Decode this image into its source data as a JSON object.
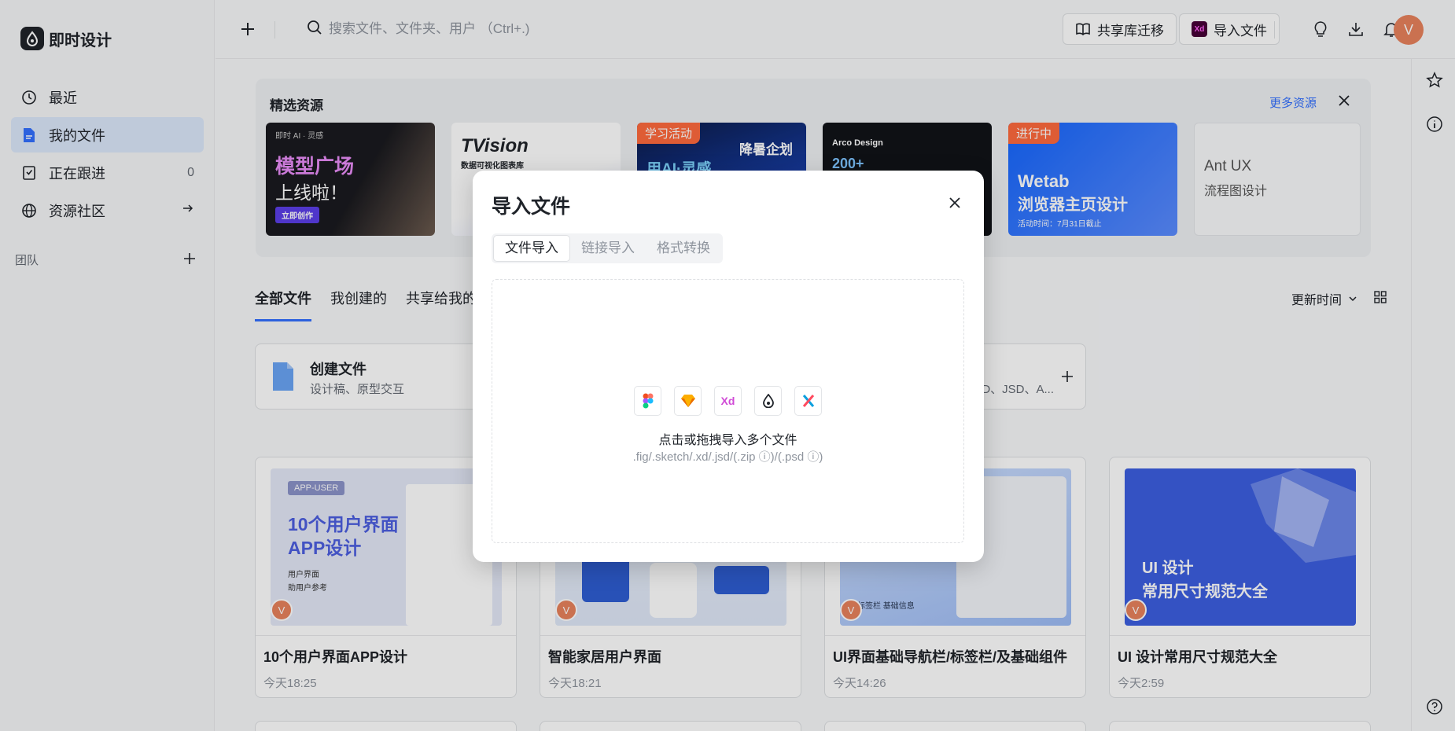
{
  "app": {
    "name": "即时设计"
  },
  "sidebar": {
    "items": [
      {
        "label": "最近",
        "icon": "clock-icon"
      },
      {
        "label": "我的文件",
        "icon": "file-icon",
        "active": true
      },
      {
        "label": "正在跟进",
        "icon": "bookmark-icon",
        "count": "0"
      },
      {
        "label": "资源社区",
        "icon": "globe-icon"
      }
    ],
    "team_label": "团队"
  },
  "topbar": {
    "search_placeholder": "搜索文件、文件夹、用户 （Ctrl+.)",
    "share_button": "共享库迁移",
    "import_button": "导入文件",
    "import_badge": "Xd",
    "avatar": "V"
  },
  "featured": {
    "title": "精选资源",
    "more": "更多资源",
    "banners": [
      {
        "top_text": "即时 AI · 灵感",
        "line1": "模型广场",
        "line2": "上线啦！",
        "cta": "立即创作"
      },
      {
        "line1": "TVision",
        "line2": "数据可视化图表库"
      },
      {
        "tag": "学习活动",
        "line1": "用AI·灵感",
        "line2": "降暑企划"
      },
      {
        "top_text": "Arco Design",
        "line1": "200+"
      },
      {
        "tag": "进行中",
        "line1": "Wetab",
        "line2": "浏览器主页设计",
        "line3": "活动时间：7月31日截止"
      },
      {
        "line1": "Ant UX",
        "line2": "流程图设计"
      }
    ]
  },
  "tabs": [
    {
      "label": "全部文件",
      "active": true
    },
    {
      "label": "我创建的"
    },
    {
      "label": "共享给我的"
    }
  ],
  "sort": {
    "label": "更新时间"
  },
  "create_card": {
    "title": "创建文件",
    "subtitle": "设计稿、原型交互",
    "right_text": "D、JSD、A..."
  },
  "files": [
    {
      "name": "10个用户界面APP设计",
      "time": "今天18:25",
      "thumb_tag": "APP-USER",
      "thumb_line1": "10个用户界面",
      "thumb_line2": "APP设计",
      "thumb_item1": "用户界面",
      "thumb_item2": "助用户参考",
      "avatar": "V"
    },
    {
      "name": "智能家居用户界面",
      "time": "今天18:21",
      "avatar": "V"
    },
    {
      "name": "UI界面基础导航栏/标签栏/及基础组件",
      "time": "今天14:26",
      "thumb_line1": "标签栏 基础信息",
      "avatar": "V"
    },
    {
      "name": "UI 设计常用尺寸规范大全",
      "time": "今天2:59",
      "thumb_line1": "UI 设计",
      "thumb_line2": "常用尺寸规范大全",
      "avatar": "V"
    }
  ],
  "dialog": {
    "title": "导入文件",
    "tabs": [
      {
        "label": "文件导入",
        "active": true
      },
      {
        "label": "链接导入"
      },
      {
        "label": "格式转换"
      }
    ],
    "formats": [
      "figma-icon",
      "sketch-icon",
      "xd-icon",
      "jsd-icon",
      "axure-icon"
    ],
    "xd_text": "Xd",
    "drop_text": "点击或拖拽导入多个文件",
    "drop_sub": ".fig/.sketch/.xd/.jsd/(.zip ⓘ)/(.psd ⓘ)"
  },
  "colors": {
    "accent": "#3370ff",
    "active_nav": "#dce8fb",
    "avatar": "#e8825c"
  }
}
